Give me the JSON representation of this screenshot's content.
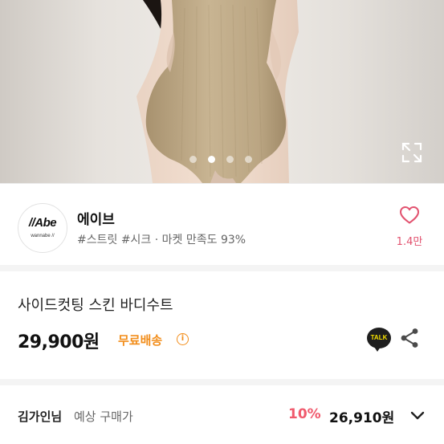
{
  "gallery": {
    "dot_count": 4,
    "active_dot": 1,
    "expand_icon": "expand-icon"
  },
  "shop": {
    "logo_text": "//Abe",
    "logo_subtext": "wannabe //",
    "name": "에이브",
    "tags": "#스트릿 #시크 · 마켓 만족도 93%",
    "like_icon": "heart-outline-icon",
    "like_count": "1.4만",
    "accent_color": "#e2526f"
  },
  "product": {
    "title": "사이드컷팅 스킨 바디수트",
    "price": "29,900원",
    "shipping_label": "무료배송",
    "shipping_color": "#f28d1a",
    "info_icon": "info-icon",
    "talk_label": "TALK",
    "share_icon": "share-icon"
  },
  "buyer_price": {
    "buyer_name": "김가인님",
    "label": "예상 구매가",
    "discount": "10%",
    "final_price": "26,910원",
    "discount_color": "#f05a6d",
    "chevron_icon": "chevron-down-icon"
  }
}
